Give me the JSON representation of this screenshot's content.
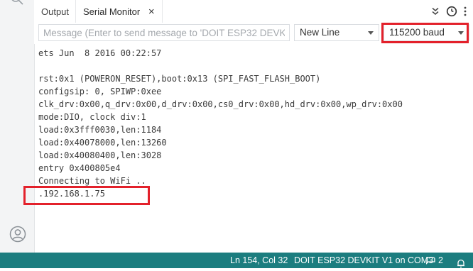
{
  "tabs": {
    "output_label": "Output",
    "serial_label": "Serial Monitor",
    "close_glyph": "×"
  },
  "toolbar": {
    "message_placeholder": "Message (Enter to send message to 'DOIT ESP32 DEVKI...",
    "line_ending": "New Line",
    "baud_rate": "115200 baud"
  },
  "console": {
    "lines": [
      "ets Jun  8 2016 00:22:57",
      "",
      "rst:0x1 (POWERON_RESET),boot:0x13 (SPI_FAST_FLASH_BOOT)",
      "configsip: 0, SPIWP:0xee",
      "clk_drv:0x00,q_drv:0x00,d_drv:0x00,cs0_drv:0x00,hd_drv:0x00,wp_drv:0x00",
      "mode:DIO, clock div:1",
      "load:0x3fff0030,len:1184",
      "load:0x40078000,len:13260",
      "load:0x40080400,len:3028",
      "entry 0x400805e4",
      "Connecting to WiFi ..",
      ".192.168.1.75"
    ]
  },
  "status": {
    "position": "Ln 154, Col 32",
    "board": "DOIT ESP32 DEVKIT V1 on COM3",
    "notifications": "2"
  },
  "colors": {
    "status_bar": "#1c7d7f",
    "highlight": "#e3212b"
  }
}
